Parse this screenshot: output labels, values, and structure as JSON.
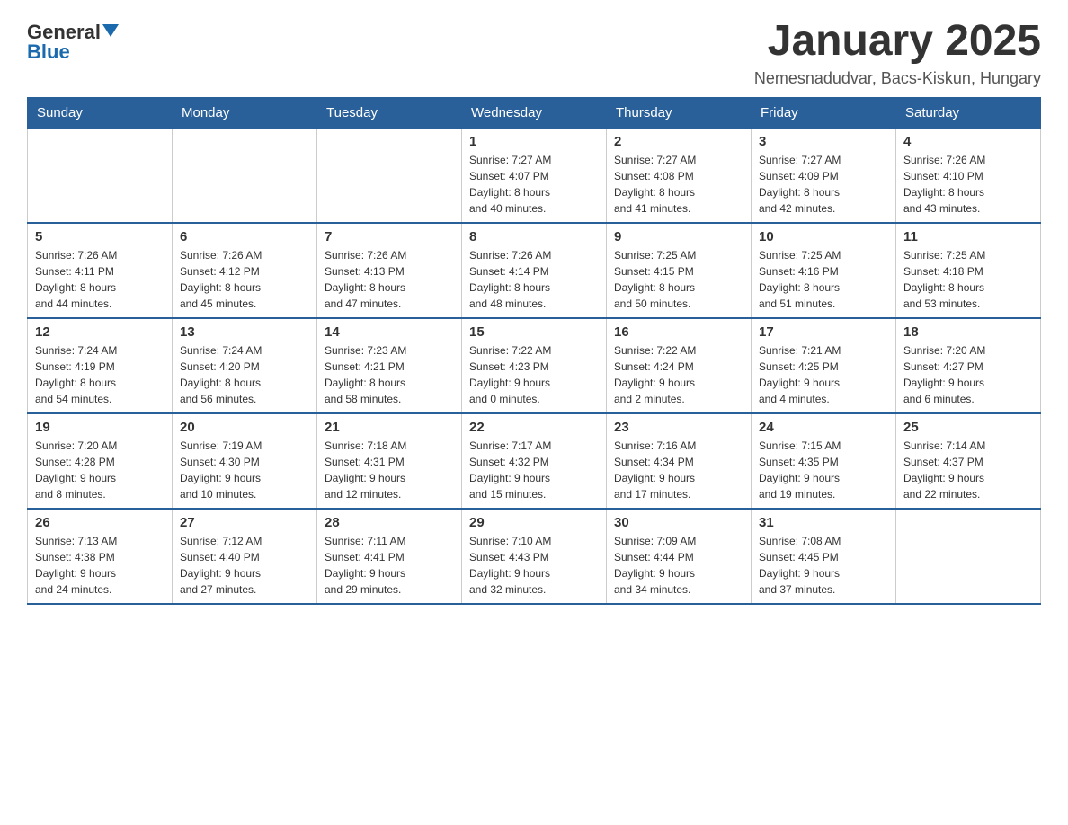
{
  "header": {
    "logo_general": "General",
    "logo_blue": "Blue",
    "month_title": "January 2025",
    "location": "Nemesnadudvar, Bacs-Kiskun, Hungary"
  },
  "days_of_week": [
    "Sunday",
    "Monday",
    "Tuesday",
    "Wednesday",
    "Thursday",
    "Friday",
    "Saturday"
  ],
  "weeks": [
    [
      {
        "day": "",
        "info": ""
      },
      {
        "day": "",
        "info": ""
      },
      {
        "day": "",
        "info": ""
      },
      {
        "day": "1",
        "info": "Sunrise: 7:27 AM\nSunset: 4:07 PM\nDaylight: 8 hours\nand 40 minutes."
      },
      {
        "day": "2",
        "info": "Sunrise: 7:27 AM\nSunset: 4:08 PM\nDaylight: 8 hours\nand 41 minutes."
      },
      {
        "day": "3",
        "info": "Sunrise: 7:27 AM\nSunset: 4:09 PM\nDaylight: 8 hours\nand 42 minutes."
      },
      {
        "day": "4",
        "info": "Sunrise: 7:26 AM\nSunset: 4:10 PM\nDaylight: 8 hours\nand 43 minutes."
      }
    ],
    [
      {
        "day": "5",
        "info": "Sunrise: 7:26 AM\nSunset: 4:11 PM\nDaylight: 8 hours\nand 44 minutes."
      },
      {
        "day": "6",
        "info": "Sunrise: 7:26 AM\nSunset: 4:12 PM\nDaylight: 8 hours\nand 45 minutes."
      },
      {
        "day": "7",
        "info": "Sunrise: 7:26 AM\nSunset: 4:13 PM\nDaylight: 8 hours\nand 47 minutes."
      },
      {
        "day": "8",
        "info": "Sunrise: 7:26 AM\nSunset: 4:14 PM\nDaylight: 8 hours\nand 48 minutes."
      },
      {
        "day": "9",
        "info": "Sunrise: 7:25 AM\nSunset: 4:15 PM\nDaylight: 8 hours\nand 50 minutes."
      },
      {
        "day": "10",
        "info": "Sunrise: 7:25 AM\nSunset: 4:16 PM\nDaylight: 8 hours\nand 51 minutes."
      },
      {
        "day": "11",
        "info": "Sunrise: 7:25 AM\nSunset: 4:18 PM\nDaylight: 8 hours\nand 53 minutes."
      }
    ],
    [
      {
        "day": "12",
        "info": "Sunrise: 7:24 AM\nSunset: 4:19 PM\nDaylight: 8 hours\nand 54 minutes."
      },
      {
        "day": "13",
        "info": "Sunrise: 7:24 AM\nSunset: 4:20 PM\nDaylight: 8 hours\nand 56 minutes."
      },
      {
        "day": "14",
        "info": "Sunrise: 7:23 AM\nSunset: 4:21 PM\nDaylight: 8 hours\nand 58 minutes."
      },
      {
        "day": "15",
        "info": "Sunrise: 7:22 AM\nSunset: 4:23 PM\nDaylight: 9 hours\nand 0 minutes."
      },
      {
        "day": "16",
        "info": "Sunrise: 7:22 AM\nSunset: 4:24 PM\nDaylight: 9 hours\nand 2 minutes."
      },
      {
        "day": "17",
        "info": "Sunrise: 7:21 AM\nSunset: 4:25 PM\nDaylight: 9 hours\nand 4 minutes."
      },
      {
        "day": "18",
        "info": "Sunrise: 7:20 AM\nSunset: 4:27 PM\nDaylight: 9 hours\nand 6 minutes."
      }
    ],
    [
      {
        "day": "19",
        "info": "Sunrise: 7:20 AM\nSunset: 4:28 PM\nDaylight: 9 hours\nand 8 minutes."
      },
      {
        "day": "20",
        "info": "Sunrise: 7:19 AM\nSunset: 4:30 PM\nDaylight: 9 hours\nand 10 minutes."
      },
      {
        "day": "21",
        "info": "Sunrise: 7:18 AM\nSunset: 4:31 PM\nDaylight: 9 hours\nand 12 minutes."
      },
      {
        "day": "22",
        "info": "Sunrise: 7:17 AM\nSunset: 4:32 PM\nDaylight: 9 hours\nand 15 minutes."
      },
      {
        "day": "23",
        "info": "Sunrise: 7:16 AM\nSunset: 4:34 PM\nDaylight: 9 hours\nand 17 minutes."
      },
      {
        "day": "24",
        "info": "Sunrise: 7:15 AM\nSunset: 4:35 PM\nDaylight: 9 hours\nand 19 minutes."
      },
      {
        "day": "25",
        "info": "Sunrise: 7:14 AM\nSunset: 4:37 PM\nDaylight: 9 hours\nand 22 minutes."
      }
    ],
    [
      {
        "day": "26",
        "info": "Sunrise: 7:13 AM\nSunset: 4:38 PM\nDaylight: 9 hours\nand 24 minutes."
      },
      {
        "day": "27",
        "info": "Sunrise: 7:12 AM\nSunset: 4:40 PM\nDaylight: 9 hours\nand 27 minutes."
      },
      {
        "day": "28",
        "info": "Sunrise: 7:11 AM\nSunset: 4:41 PM\nDaylight: 9 hours\nand 29 minutes."
      },
      {
        "day": "29",
        "info": "Sunrise: 7:10 AM\nSunset: 4:43 PM\nDaylight: 9 hours\nand 32 minutes."
      },
      {
        "day": "30",
        "info": "Sunrise: 7:09 AM\nSunset: 4:44 PM\nDaylight: 9 hours\nand 34 minutes."
      },
      {
        "day": "31",
        "info": "Sunrise: 7:08 AM\nSunset: 4:45 PM\nDaylight: 9 hours\nand 37 minutes."
      },
      {
        "day": "",
        "info": ""
      }
    ]
  ]
}
